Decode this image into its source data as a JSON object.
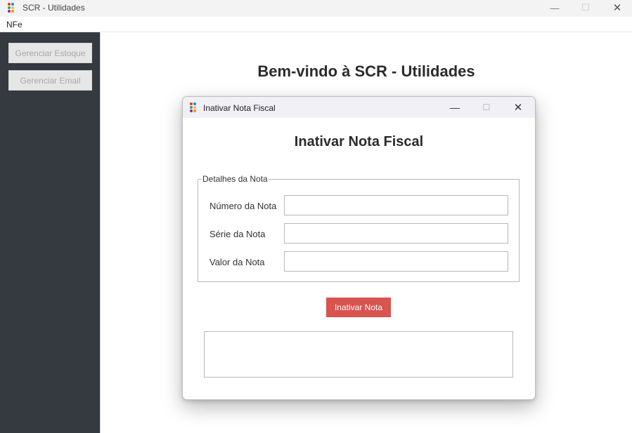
{
  "window": {
    "title": "SCR - Utilidades",
    "controls": {
      "minimize": "—",
      "maximize": "☐",
      "close": "✕"
    }
  },
  "menubar": {
    "items": [
      {
        "label": "NFe"
      }
    ]
  },
  "sidebar": {
    "background": "#343a40",
    "buttons": [
      {
        "label": "Gerenciar Estoque"
      },
      {
        "label": "Gerenciar Email"
      }
    ]
  },
  "main": {
    "welcome": "Bem-vindo à SCR - Utilidades"
  },
  "dialog": {
    "title": "Inativar Nota Fiscal",
    "heading": "Inativar Nota Fiscal",
    "controls": {
      "minimize": "—",
      "maximize": "☐",
      "close": "✕"
    },
    "fieldset_legend": "Detalhes da Nota",
    "fields": [
      {
        "label": "Número da Nota",
        "value": ""
      },
      {
        "label": "Série da Nota",
        "value": ""
      },
      {
        "label": "Valor da Nota",
        "value": ""
      }
    ],
    "action_button": {
      "label": "Inativar Nota",
      "color": "#d9534f"
    },
    "output": {
      "value": ""
    }
  },
  "icon": {
    "name": "app-logo-icon",
    "colors": [
      "#e53935",
      "#1e88e5",
      "#43a047",
      "#fbc02d",
      "#8e24aa",
      "#fb8c00"
    ]
  }
}
